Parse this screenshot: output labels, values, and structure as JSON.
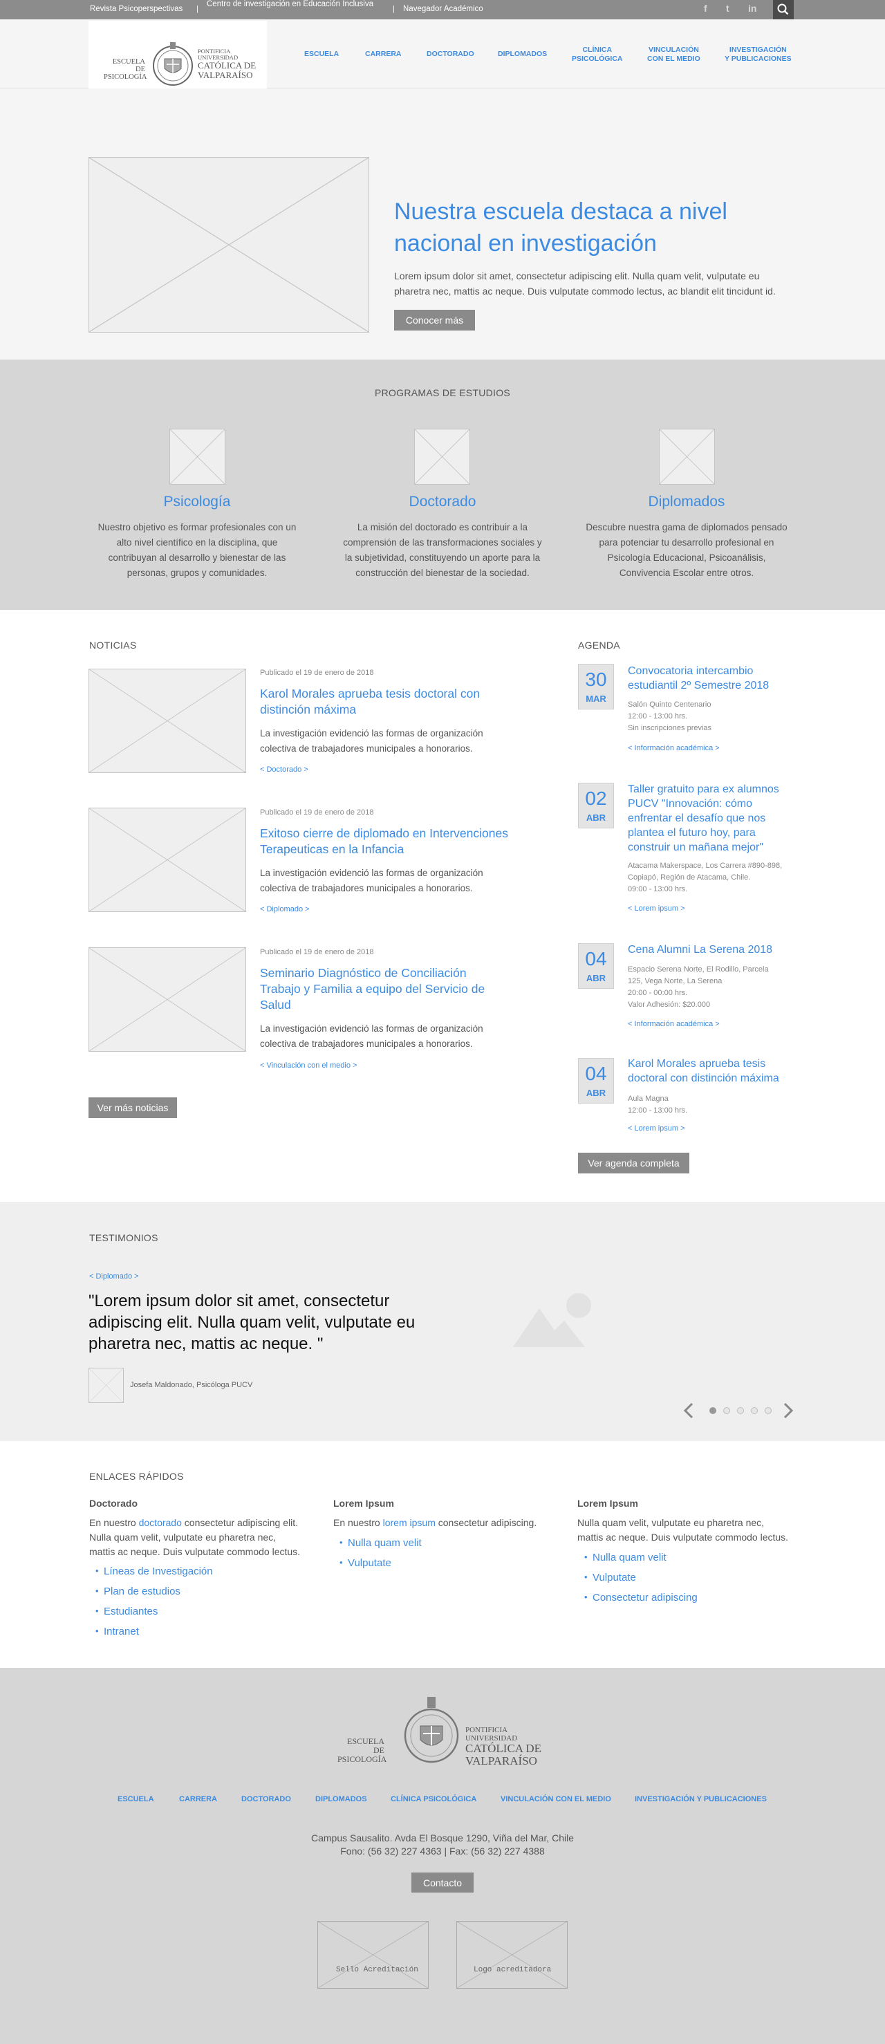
{
  "topbar": {
    "links": [
      "Revista Psicoperspectivas",
      "Centro de investigación en Educación Inclusiva",
      "Navegador Académico"
    ],
    "separator": "|",
    "social": [
      "facebook-icon",
      "twitter-icon",
      "linkedin-icon"
    ],
    "social_glyphs": [
      "f",
      "t",
      "in"
    ],
    "search": "search-icon"
  },
  "logo": {
    "left_line1": "ESCUELA DE",
    "left_line2": "PSICOLOGÍA",
    "right_line1": "PONTIFICIA",
    "right_line2": "UNIVERSIDAD",
    "right_line3": "CATÓLICA DE",
    "right_line4": "VALPARAÍSO"
  },
  "nav": [
    {
      "l1": "ESCUELA",
      "l2": ""
    },
    {
      "l1": "CARRERA",
      "l2": ""
    },
    {
      "l1": "DOCTORADO",
      "l2": ""
    },
    {
      "l1": "DIPLOMADOS",
      "l2": ""
    },
    {
      "l1": "CLÍNICA",
      "l2": "PSICOLÓGICA"
    },
    {
      "l1": "VINCULACIÓN",
      "l2": "CON EL MEDIO"
    },
    {
      "l1": "INVESTIGACIÓN",
      "l2": "Y PUBLICACIONES"
    }
  ],
  "hero": {
    "title": "Nuestra escuela destaca a nivel nacional en investigación",
    "text": "Lorem ipsum dolor sit amet, consectetur adipiscing elit. Nulla quam velit, vulputate eu pharetra nec, mattis ac neque. Duis vulputate commodo lectus, ac blandit elit tincidunt id.",
    "button": "Conocer más"
  },
  "programs": {
    "title": "PROGRAMAS DE ESTUDIOS",
    "items": [
      {
        "title": "Psicología",
        "text": "Nuestro objetivo es formar profesionales con un alto nivel científico en la  disciplina, que contribuyan al desarrollo y bienestar de las personas, grupos y comunidades."
      },
      {
        "title": "Doctorado",
        "text": "La misión del doctorado es contribuir a la comprensión de las transformaciones sociales y la subjetividad, constituyendo un aporte para la construcción del bienestar de la sociedad."
      },
      {
        "title": "Diplomados",
        "text": "Descubre nuestra gama de diplomados pensado para potenciar tu desarrollo profesional en Psicología Educacional, Psicoanálisis, Convivencia Escolar entre otros."
      }
    ]
  },
  "news": {
    "title": "NOTICIAS",
    "items": [
      {
        "date": "Publicado el 19 de enero de 2018",
        "title": "Karol Morales aprueba tesis doctoral con distinción máxima",
        "text": "La investigación evidenció las formas de organización colectiva de trabajadores municipales a honorarios.",
        "tag": "< Doctorado >"
      },
      {
        "date": "Publicado el 19 de enero de 2018",
        "title": "Exitoso cierre de diplomado en Intervenciones Terapeuticas en la Infancia",
        "text": "La investigación evidenció las formas de organización colectiva de trabajadores municipales a honorarios.",
        "tag": "< Diplomado >"
      },
      {
        "date": "Publicado el 19 de enero de 2018",
        "title": "Seminario Diagnóstico de Conciliación Trabajo y Familia a equipo del Servicio de Salud",
        "text": "La investigación evidenció las formas de organización colectiva de trabajadores municipales a honorarios.",
        "tag": "< Vinculación con el medio >"
      }
    ],
    "more": "Ver más noticias"
  },
  "agenda": {
    "title": "AGENDA",
    "items": [
      {
        "day": "30",
        "month": "MAR",
        "title": "Convocatoria intercambio estudiantil 2º Semestre 2018",
        "info": [
          "Salón Quinto Centenario",
          "12:00 - 13:00 hrs.",
          "Sin inscripciones previas"
        ],
        "tag": "< Información académica  >"
      },
      {
        "day": "02",
        "month": "ABR",
        "title": "Taller gratuito para ex alumnos PUCV \"Innovación: cómo enfrentar el desafío que nos plantea el futuro hoy, para construir un mañana mejor\"",
        "info": [
          "Atacama Makerspace, Los Carrera #890-898,",
          "Copiapó, Región de Atacama, Chile.",
          "09:00 - 13:00 hrs."
        ],
        "tag": "< Lorem ipsum >"
      },
      {
        "day": "04",
        "month": "ABR",
        "title": "Cena Alumni La Serena 2018",
        "info": [
          "Espacio Serena Norte, El Rodillo, Parcela",
          "125, Vega Norte, La Serena",
          "20:00 - 00:00 hrs.",
          "Valor Adhesión:  $20.000"
        ],
        "tag": "< Información académica  >"
      },
      {
        "day": "04",
        "month": "ABR",
        "title": "Karol Morales aprueba tesis doctoral con distinción máxima",
        "info": [
          "Aula Magna",
          "12:00 - 13:00 hrs."
        ],
        "tag": "< Lorem ipsum >"
      }
    ],
    "more": "Ver agenda completa"
  },
  "testimonials": {
    "title": "TESTIMONIOS",
    "tag": "< Diplomado >",
    "quote": "\"Lorem ipsum dolor sit amet, consectetur adipiscing elit. Nulla quam velit, vulputate eu pharetra nec, mattis ac neque. \"",
    "author": "Josefa Maldonado, Psicóloga PUCV",
    "slides_total": 5,
    "slide_current": 1
  },
  "quicklinks": {
    "title": "ENLACES RÁPIDOS",
    "cols": [
      {
        "heading": "Doctorado",
        "pre": "En nuestro ",
        "link": "doctorado",
        "post": " consectetur adipiscing elit. Nulla quam velit, vulputate eu pharetra nec, mattis ac neque. Duis vulputate commodo lectus.",
        "items": [
          "Líneas de Investigación",
          "Plan de estudios",
          "Estudiantes",
          "Intranet"
        ]
      },
      {
        "heading": "Lorem Ipsum",
        "pre": "En nuestro ",
        "link": "lorem ipsum",
        "post": " consectetur adipiscing.",
        "items": [
          "Nulla quam velit",
          "Vulputate"
        ]
      },
      {
        "heading": "Lorem Ipsum",
        "pre": "Nulla quam velit, vulputate eu pharetra nec, mattis ac neque. Duis vulputate commodo lectus.",
        "link": "",
        "post": "",
        "items": [
          "Nulla quam velit",
          "Vulputate",
          "Consectetur adipiscing"
        ]
      }
    ]
  },
  "footer": {
    "nav": [
      "ESCUELA",
      "CARRERA",
      "DOCTORADO",
      "DIPLOMADOS",
      "CLÍNICA PSICOLÓGICA",
      "VINCULACIÓN CON EL MEDIO",
      "INVESTIGACIÓN Y PUBLICACIONES"
    ],
    "address": "Campus Sausalito. Avda El Bosque 1290, Viña del Mar, Chile",
    "phone": "Fono: (56 32) 227 4363 | Fax: (56 32) 227 4388",
    "contact": "Contacto",
    "seals": [
      "Sello Acreditación",
      "Logo acreditadora"
    ]
  }
}
